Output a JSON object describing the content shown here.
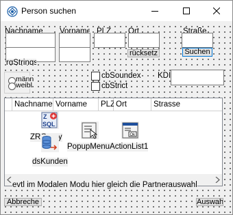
{
  "window": {
    "title": "Person suchen"
  },
  "fields": {
    "nachname_label": "Nachname",
    "vorname_label": "Vorname",
    "plz_label": "PLZ",
    "ort_label": "Ort",
    "strasse_label": "Straße"
  },
  "buttons": {
    "reset": "rücksetz",
    "search": "Suchen",
    "cancel": "Abbreche",
    "select": "Auswah"
  },
  "hidden_label": "rgStrings",
  "gender": {
    "male": "männ",
    "female": "weibl"
  },
  "options": {
    "soundex": "cbSoundex",
    "strict": "cbStrict",
    "kdid_label": "KDID"
  },
  "grid": {
    "columns": [
      "Nachname",
      "Vorname",
      "PLZ",
      "Ort",
      "Strasse"
    ]
  },
  "components": {
    "query": "ZRQuery",
    "popup": "PopupMenuActionList1",
    "datasource": "dsKunden"
  },
  "note": "evtl im Modalen Modu hier gleich die Partnerauswahl"
}
